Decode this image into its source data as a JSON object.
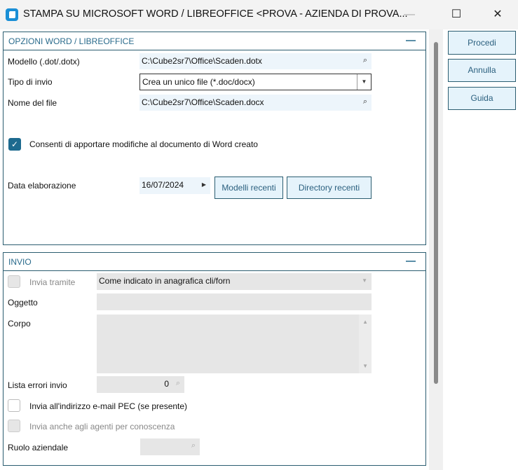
{
  "window": {
    "title": "STAMPA SU MICROSOFT WORD / LIBREOFFICE <PROVA - AZIENDA DI PROVA...",
    "min": "—",
    "max": "☐",
    "close": "✕"
  },
  "word": {
    "title": "OPZIONI WORD / LIBREOFFICE",
    "modello_label": "Modello (.dot/.dotx)",
    "modello_value": "C:\\Cube2sr7\\Office\\Scaden.dotx",
    "tipo_label": "Tipo di invio",
    "tipo_value": "Crea un unico file (*.doc/docx)",
    "nome_label": "Nome del file",
    "nome_value": "C:\\Cube2sr7\\Office\\Scaden.docx",
    "consenti_label": "Consenti di apportare modifiche al documento di Word creato",
    "consenti_checked": true,
    "data_label": "Data elaborazione",
    "data_value": "16/07/2024",
    "modelli_recenti": "Modelli recenti",
    "directory_recenti": "Directory recenti"
  },
  "invio": {
    "title": "INVIO",
    "invia_tramite_label": "Invia tramite",
    "invia_tramite_value": "Come indicato in anagrafica cli/forn",
    "oggetto_label": "Oggetto",
    "oggetto_value": "",
    "corpo_label": "Corpo",
    "corpo_value": "",
    "lista_label": "Lista errori invio",
    "lista_value": "0",
    "pec_label": "Invia all'indirizzo e-mail PEC (se presente)",
    "agenti_label": "Invia anche agli agenti per conoscenza",
    "ruolo_label": "Ruolo aziendale",
    "ruolo_value": ""
  },
  "actions": {
    "procedi": "Procedi",
    "annulla": "Annulla",
    "guida": "Guida"
  }
}
